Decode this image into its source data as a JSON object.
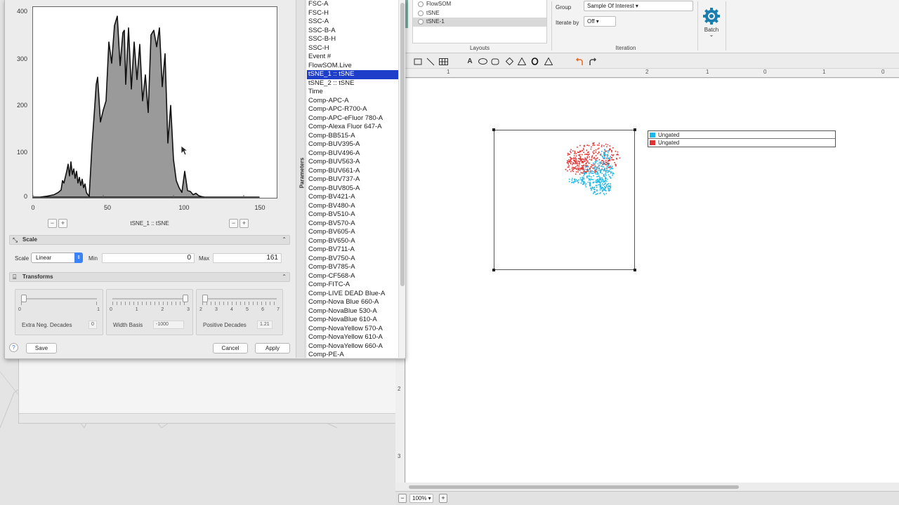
{
  "histogram": {
    "y_ticks": [
      "400",
      "300",
      "200",
      "100",
      "0"
    ],
    "x_ticks": [
      "0",
      "50",
      "100",
      "150"
    ],
    "axis_parameter": "tSNE_1 :: tSNE",
    "zoom_out": "−",
    "zoom_in": "+"
  },
  "chart_data": {
    "type": "area",
    "title": "",
    "xlabel": "tSNE_1 :: tSNE",
    "ylabel": "",
    "xlim": [
      0,
      161
    ],
    "ylim": [
      0,
      400
    ],
    "x": [
      0,
      5,
      10,
      15,
      18,
      20,
      21,
      22,
      24,
      25,
      26,
      27,
      28,
      29,
      30,
      31,
      32,
      33,
      34,
      35,
      36,
      37,
      38,
      39,
      40,
      42,
      44,
      45,
      46,
      48,
      50,
      52,
      54,
      56,
      58,
      60,
      62,
      64,
      65,
      66,
      68,
      70,
      72,
      74,
      76,
      78,
      80,
      82,
      84,
      86,
      88,
      90,
      92,
      94,
      96,
      98,
      100,
      102,
      104,
      106,
      108,
      110,
      112,
      114,
      116,
      118,
      120,
      122,
      124,
      126,
      128,
      130,
      132,
      134,
      136,
      138,
      140,
      145,
      150,
      161
    ],
    "values": [
      0,
      0,
      2,
      5,
      10,
      15,
      35,
      30,
      55,
      70,
      45,
      75,
      48,
      60,
      40,
      55,
      30,
      42,
      25,
      38,
      20,
      28,
      10,
      5,
      2,
      110,
      195,
      240,
      255,
      160,
      185,
      205,
      330,
      285,
      365,
      385,
      280,
      350,
      355,
      240,
      360,
      230,
      330,
      250,
      325,
      205,
      260,
      180,
      345,
      355,
      320,
      360,
      235,
      305,
      115,
      195,
      80,
      35,
      20,
      10,
      55,
      14,
      12,
      5,
      8,
      3,
      1,
      0,
      0,
      0,
      0,
      0,
      0,
      0,
      0,
      0,
      0,
      0,
      0,
      0
    ]
  },
  "scale": {
    "title": "Scale",
    "scale_label": "Scale",
    "scale_value": "Linear",
    "min_label": "Min",
    "min_value": "0",
    "max_label": "Max",
    "max_value": "161"
  },
  "transforms": {
    "title": "Transforms",
    "extra_neg": {
      "label": "Extra Neg. Decades",
      "value": "0",
      "ticks": [
        "0",
        "1"
      ]
    },
    "width_basis": {
      "label": "Width Basis",
      "value": "-1000",
      "ticks": [
        "0",
        "1",
        "2",
        "3"
      ]
    },
    "positive_decades": {
      "label": "Positive Decades",
      "value": "1.21",
      "ticks": [
        "2",
        "3",
        "4",
        "5",
        "6",
        "7"
      ]
    }
  },
  "buttons": {
    "help": "?",
    "save": "Save",
    "cancel": "Cancel",
    "apply": "Apply"
  },
  "parameters": {
    "tab_label": "Parameters",
    "items": [
      "FSC-A",
      "FSC-H",
      "SSC-A",
      "SSC-B-A",
      "SSC-B-H",
      "SSC-H",
      "Event #",
      "FlowSOM.Live",
      "tSNE_1 :: tSNE",
      "tSNE_2 :: tSNE",
      "Time",
      "Comp-APC-A",
      "Comp-APC-R700-A",
      "Comp-APC-eFluor 780-A",
      "Comp-Alexa Fluor 647-A",
      "Comp-BB515-A",
      "Comp-BUV395-A",
      "Comp-BUV496-A",
      "Comp-BUV563-A",
      "Comp-BUV661-A",
      "Comp-BUV737-A",
      "Comp-BUV805-A",
      "Comp-BV421-A",
      "Comp-BV480-A",
      "Comp-BV510-A",
      "Comp-BV570-A",
      "Comp-BV605-A",
      "Comp-BV650-A",
      "Comp-BV711-A",
      "Comp-BV750-A",
      "Comp-BV785-A",
      "Comp-CF568-A",
      "Comp-FITC-A",
      "Comp-LIVE DEAD Blue-A",
      "Comp-Nova Blue 660-A",
      "Comp-NovaBlue 530-A",
      "Comp-NovaBlue 610-A",
      "Comp-NovaYellow 570-A",
      "Comp-NovaYellow 610-A",
      "Comp-NovaYellow 660-A",
      "Comp-PE-A"
    ],
    "selected_index": 8
  },
  "ribbon": {
    "layouts": [
      "FlowSOM",
      "tSNE",
      "tSNE-1"
    ],
    "layouts_selected_index": 2,
    "layouts_group": "Layouts",
    "group_label": "Group",
    "group_value": "Sample Of Interest ▾",
    "iterate_label": "Iterate by",
    "iterate_value": "Off ▾",
    "iteration_group": "Iteration",
    "batch_label": "Batch",
    "batch_caret": "⌄"
  },
  "ruler": {
    "top": [
      "1",
      "2",
      "1",
      "0",
      "1",
      "0"
    ],
    "left": [
      "2",
      "3"
    ]
  },
  "legend": [
    {
      "label": "Ungated",
      "color": "#1cb8e8"
    },
    {
      "label": "Ungated",
      "color": "#e03434"
    }
  ],
  "status": {
    "zoom": "100% ▾",
    "zoom_minus": "−",
    "zoom_plus": "+"
  },
  "colors": {
    "selection": "#1e3ec9",
    "accent": "#1a7fb0",
    "tsne_blue": "#1cb8e8",
    "tsne_red": "#e03434"
  },
  "icons": [
    "gear-icon",
    "undo-icon",
    "redo-icon",
    "rectangle-tool-icon",
    "line-tool-icon",
    "table-tool-icon",
    "text-tool-icon",
    "ellipse-tool-icon",
    "rounded-rect-tool-icon",
    "diamond-tool-icon",
    "triangle-tool-icon"
  ]
}
